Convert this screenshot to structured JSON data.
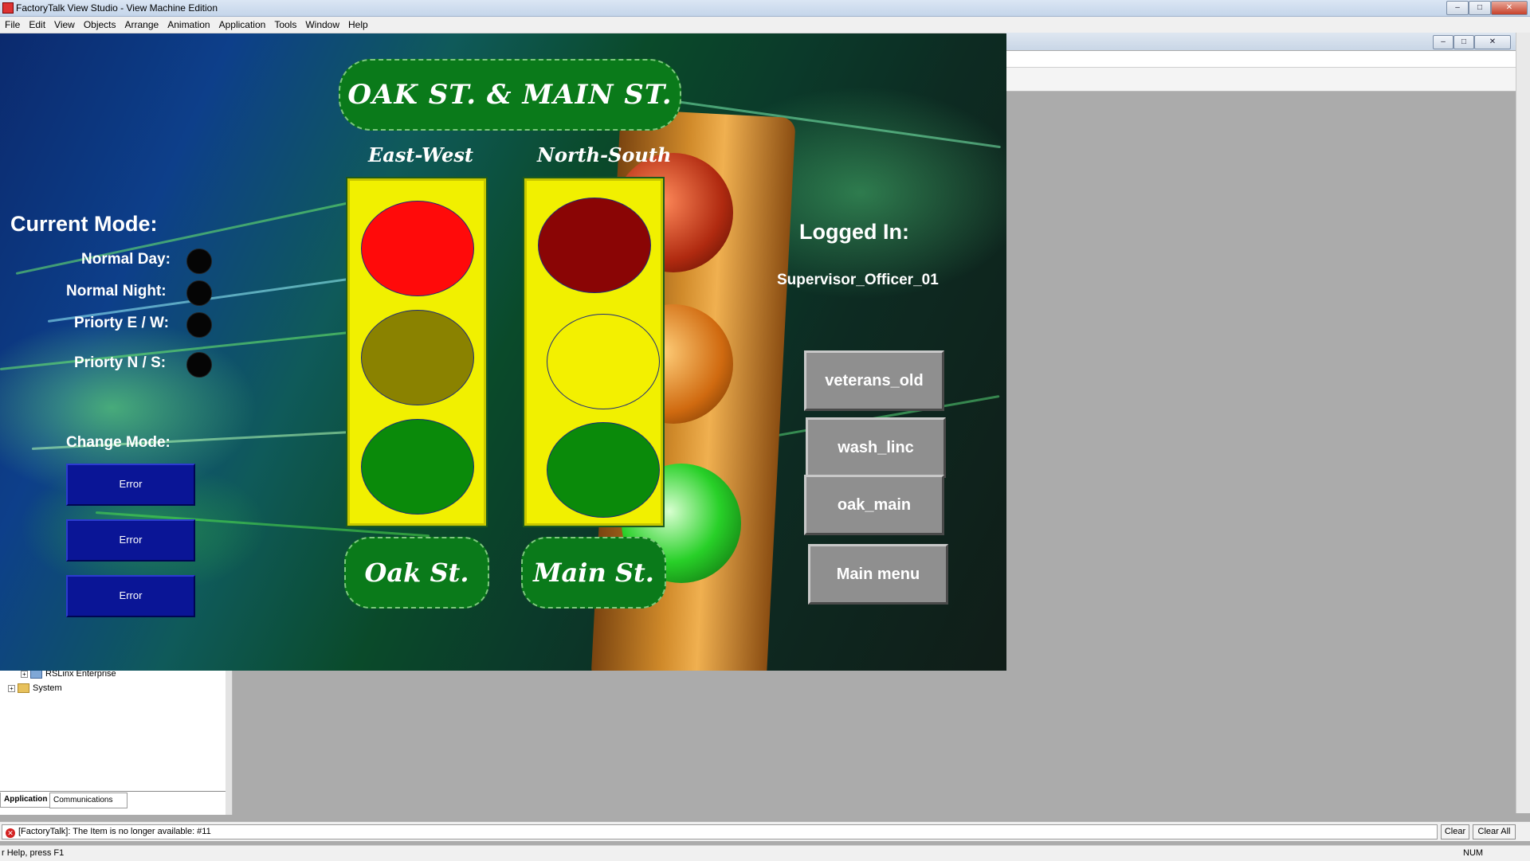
{
  "window": {
    "title": "FactoryTalk View Studio - View Machine Edition",
    "controls": [
      "–",
      "□",
      "✕"
    ]
  },
  "menu": [
    "File",
    "Edit",
    "View",
    "Objects",
    "Arrange",
    "Animation",
    "Application",
    "Tools",
    "Window",
    "Help"
  ],
  "hmi": {
    "title": "OAK ST. & MAIN ST.",
    "direction_labels": {
      "east_west": "East-West",
      "north_south": "North-South"
    },
    "street_labels": {
      "left": "Oak St.",
      "right": "Main St."
    },
    "current_mode": {
      "heading": "Current Mode:",
      "modes": [
        "Normal Day:",
        "Normal Night:",
        "Priorty E / W:",
        "Priorty N / S:"
      ]
    },
    "change_mode": {
      "heading": "Change Mode:",
      "buttons": [
        "Error",
        "Error",
        "Error"
      ]
    },
    "login": {
      "heading": "Logged In:",
      "user": "Supervisor_Officer_01"
    },
    "nav_buttons": [
      "veterans_old",
      "wash_linc",
      "oak_main",
      "Main menu"
    ],
    "colors": {
      "ew_red": "#ff0a0a",
      "ew_yellow": "#8a8200",
      "ew_green": "#0a8a0a",
      "ns_red": "#8a0505",
      "ns_yellow": "#f3f000",
      "ns_green": "#0a8a0a",
      "housing": "#f1f000",
      "title_bg": "#0a7a1a",
      "error_button": "#0a1596",
      "nav_button": "#8f8f8f"
    }
  },
  "explorer": {
    "items": [
      "RSLinx Enterprise",
      "System"
    ],
    "tabs": [
      "Application",
      "Communications"
    ]
  },
  "output": {
    "message": "[FactoryTalk]: The Item is no longer available: #11",
    "buttons": [
      "Clear",
      "Clear All"
    ]
  },
  "status": {
    "help": "r Help, press F1",
    "num": "NUM"
  }
}
